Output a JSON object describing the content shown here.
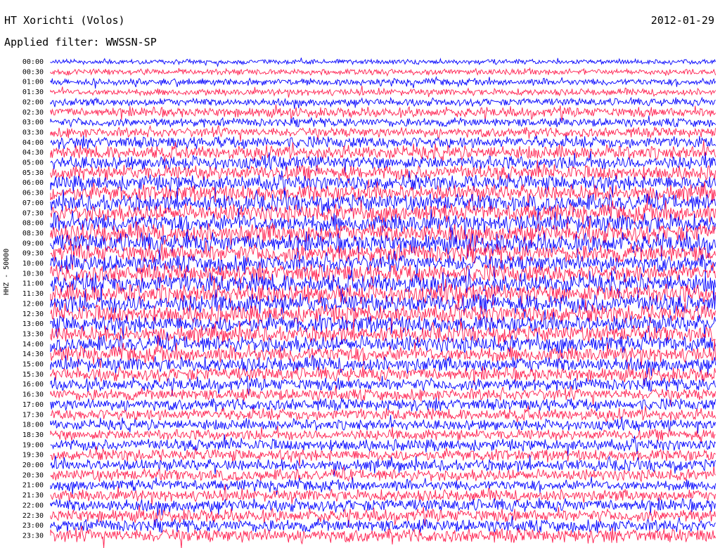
{
  "header": {
    "station": "HT Xorichti (Volos)",
    "date": "2012-01-29",
    "filter": "Applied filter: WWSSN-SP"
  },
  "axis": {
    "channel_label": "HHZ - 50000"
  },
  "chart_data": {
    "type": "line",
    "title": "HT Xorichti (Volos)",
    "subtitle": "Applied filter: WWSSN-SP",
    "date": "2012-01-29",
    "ylabel": "HHZ - 50000",
    "row_labels": [
      "00:00",
      "00:30",
      "01:00",
      "01:30",
      "02:00",
      "02:30",
      "03:00",
      "03:30",
      "04:00",
      "04:30",
      "05:00",
      "05:30",
      "06:00",
      "06:30",
      "07:00",
      "07:30",
      "08:00",
      "08:30",
      "09:00",
      "09:30",
      "10:00",
      "10:30",
      "11:00",
      "11:30",
      "12:00",
      "12:30",
      "13:00",
      "13:30",
      "14:00",
      "14:30",
      "15:00",
      "15:30",
      "16:00",
      "16:30",
      "17:00",
      "17:30",
      "18:00",
      "18:30",
      "19:00",
      "19:30",
      "20:00",
      "20:30",
      "21:00",
      "21:30",
      "22:00",
      "22:30",
      "23:00",
      "23:30"
    ],
    "trace_colors": [
      "#0000ff",
      "#ff1f4f"
    ],
    "row_amplitude": [
      0.25,
      0.3,
      0.35,
      0.35,
      0.4,
      0.5,
      0.45,
      0.5,
      0.6,
      0.7,
      0.7,
      0.75,
      0.8,
      0.85,
      0.9,
      0.9,
      0.95,
      1.0,
      1.0,
      0.95,
      0.9,
      0.95,
      1.0,
      1.0,
      1.0,
      0.95,
      0.9,
      0.85,
      0.85,
      0.8,
      0.75,
      0.7,
      0.65,
      0.6,
      0.6,
      0.6,
      0.55,
      0.55,
      0.6,
      0.6,
      0.6,
      0.6,
      0.55,
      0.6,
      0.65,
      0.65,
      0.65,
      0.7
    ],
    "grid": false,
    "legend": "none"
  }
}
